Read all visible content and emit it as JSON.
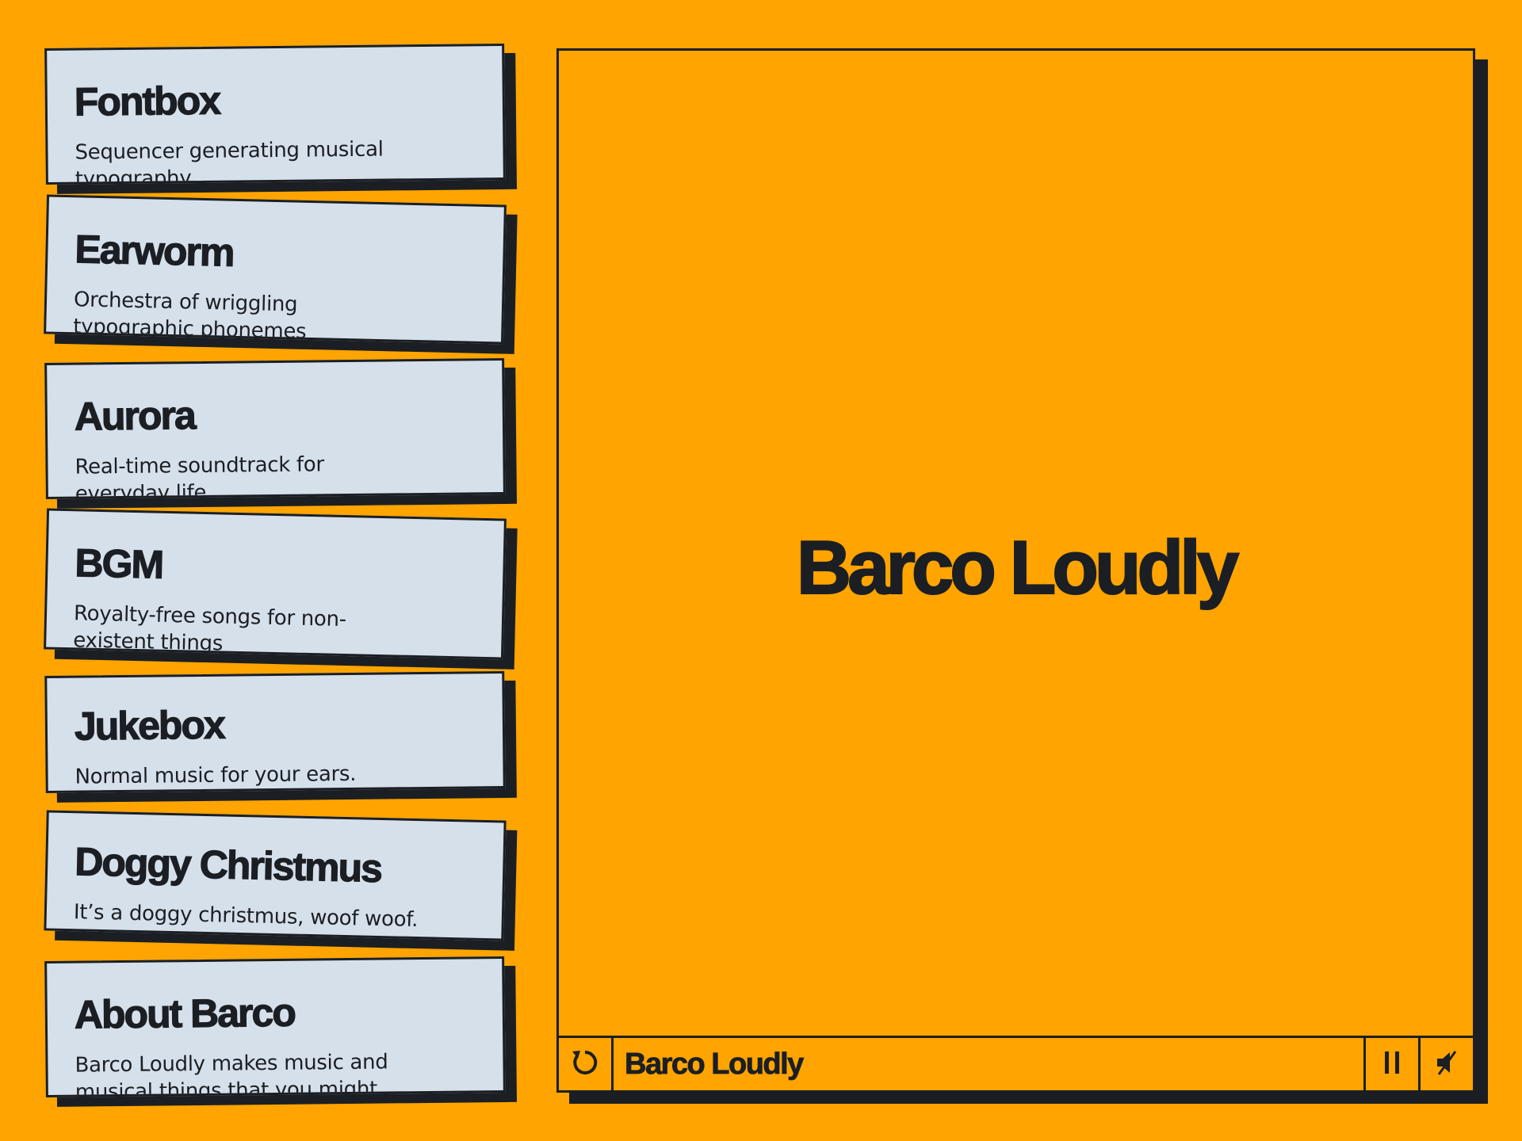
{
  "colors": {
    "background": "#FFA400",
    "card": "#D6E0EB",
    "ink": "#1b1f24"
  },
  "projects": [
    {
      "title": "Fontbox",
      "description": "Sequencer generating musical typography"
    },
    {
      "title": "Earworm",
      "description": "Orchestra of wriggling typographic phonemes"
    },
    {
      "title": "Aurora",
      "description": "Real-time soundtrack for everyday life"
    },
    {
      "title": "BGM",
      "description": "Royalty-free songs for non-existent things"
    },
    {
      "title": "Jukebox",
      "description": "Normal music for your ears."
    },
    {
      "title": "Doggy Christmus",
      "description": "It’s a doggy christmus, woof woof."
    },
    {
      "title": "About Barco",
      "description": "Barco Loudly makes music and musical things that you might"
    }
  ],
  "player": {
    "stage_title": "Barco Loudly",
    "now_playing": "Barco Loudly",
    "icons": {
      "restart": "restart-icon",
      "pause": "pause-icon",
      "mute": "mute-icon"
    }
  }
}
